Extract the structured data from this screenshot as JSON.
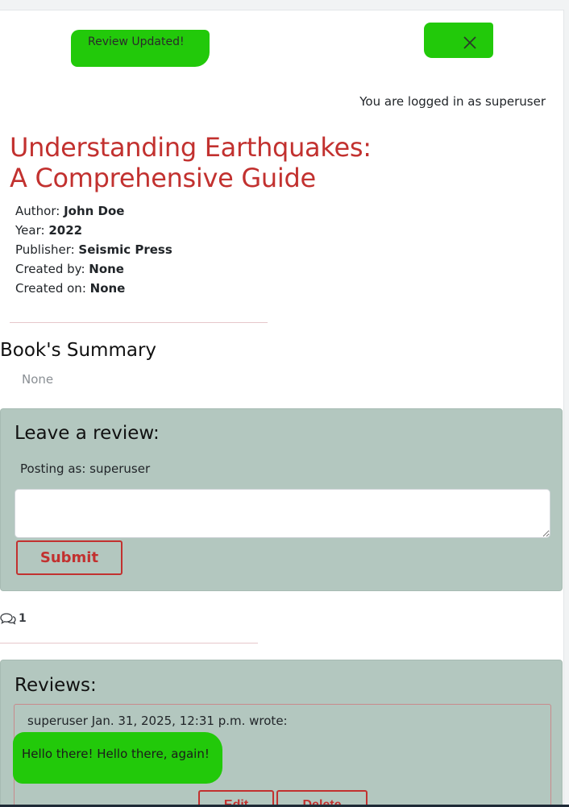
{
  "alert": {
    "message": "Review Updated!",
    "close_icon": "close-icon",
    "highlight_color": "#22c90a"
  },
  "header": {
    "logged_in_text": "You are logged in as superuser"
  },
  "book": {
    "title": "Understanding Earthquakes: A Comprehensive Guide",
    "author_label": "Author: ",
    "author": "John Doe",
    "year_label": "Year: ",
    "year": "2022",
    "publisher_label": "Publisher: ",
    "publisher": "Seismic Press",
    "created_by_label": "Created by: ",
    "created_by": "None",
    "created_on_label": "Created on: ",
    "created_on": "None"
  },
  "summary": {
    "heading": "Book's Summary",
    "text": "None"
  },
  "review_form": {
    "heading": "Leave a review:",
    "posting_as": "Posting as: superuser",
    "input_value": "",
    "submit_label": "Submit"
  },
  "comments": {
    "icon": "comments-icon",
    "count": "1"
  },
  "reviews": {
    "heading": "Reviews:",
    "items": [
      {
        "meta": "superuser Jan. 31, 2025, 12:31 p.m. wrote:",
        "body": "Hello there! Hello there, again!",
        "edit_label": "Edit",
        "delete_label": "Delete"
      }
    ]
  },
  "colors": {
    "accent": "#c2312f",
    "panel_bg": "#b3c7bf",
    "highlight": "#22c90a"
  }
}
